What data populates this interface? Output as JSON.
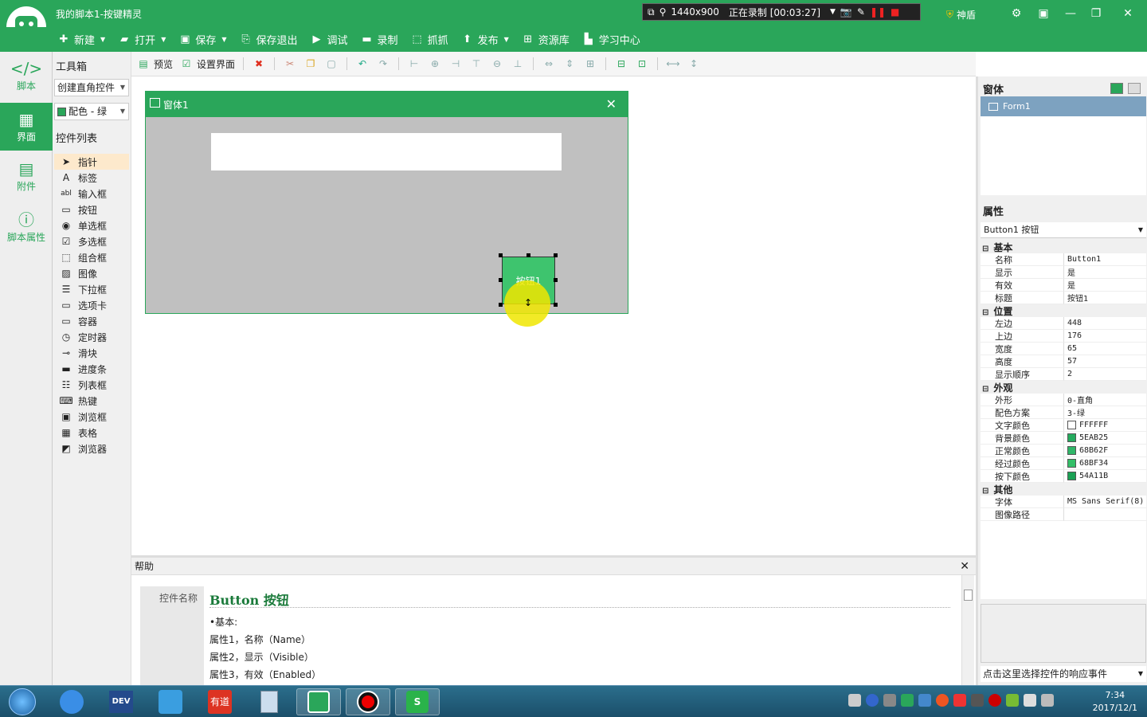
{
  "titlebar": {
    "title": "我的脚本1-按键精灵",
    "resolution": "1440x900",
    "recording": "正在录制 [00:03:27]",
    "shield": "神盾"
  },
  "menu": [
    {
      "label": "新建",
      "icon": "plus-icon",
      "dropdown": true
    },
    {
      "label": "打开",
      "icon": "folder-icon",
      "dropdown": true
    },
    {
      "label": "保存",
      "icon": "save-icon",
      "dropdown": true
    },
    {
      "label": "保存退出",
      "icon": "save-exit-icon",
      "dropdown": false
    },
    {
      "label": "调试",
      "icon": "play-icon",
      "dropdown": false
    },
    {
      "label": "录制",
      "icon": "camera-icon",
      "dropdown": false
    },
    {
      "label": "抓抓",
      "icon": "grab-icon",
      "dropdown": false
    },
    {
      "label": "发布",
      "icon": "publish-icon",
      "dropdown": true
    },
    {
      "label": "资源库",
      "icon": "resource-icon",
      "dropdown": false
    },
    {
      "label": "学习中心",
      "icon": "learn-icon",
      "dropdown": false
    }
  ],
  "leftnav": [
    {
      "label": "脚本",
      "icon": "script-icon"
    },
    {
      "label": "界面",
      "icon": "ui-icon",
      "active": true
    },
    {
      "label": "附件",
      "icon": "attachment-icon"
    },
    {
      "label": "脚本属性",
      "icon": "info-icon"
    }
  ],
  "toolbox": {
    "title": "工具箱",
    "create_mode": "创建直角控件",
    "color_scheme": "配色 - 绿",
    "list_title": "控件列表",
    "controls": [
      {
        "label": "指针",
        "icon": "pointer-icon",
        "active": true
      },
      {
        "label": "标签",
        "icon": "label-icon"
      },
      {
        "label": "输入框",
        "icon": "textbox-icon"
      },
      {
        "label": "按钮",
        "icon": "button-icon"
      },
      {
        "label": "单选框",
        "icon": "radio-icon"
      },
      {
        "label": "多选框",
        "icon": "checkbox-icon"
      },
      {
        "label": "组合框",
        "icon": "combo-icon"
      },
      {
        "label": "图像",
        "icon": "image-icon"
      },
      {
        "label": "下拉框",
        "icon": "dropdown-icon"
      },
      {
        "label": "选项卡",
        "icon": "tab-icon"
      },
      {
        "label": "容器",
        "icon": "container-icon"
      },
      {
        "label": "定时器",
        "icon": "timer-icon"
      },
      {
        "label": "滑块",
        "icon": "slider-icon"
      },
      {
        "label": "进度条",
        "icon": "progress-icon"
      },
      {
        "label": "列表框",
        "icon": "listbox-icon"
      },
      {
        "label": "热键",
        "icon": "hotkey-icon"
      },
      {
        "label": "浏览框",
        "icon": "browse-icon"
      },
      {
        "label": "表格",
        "icon": "grid-icon"
      },
      {
        "label": "浏览器",
        "icon": "browser-icon"
      }
    ]
  },
  "edittoolbar": {
    "preview": "预览",
    "settings": "设置界面"
  },
  "form": {
    "title": "窗体1",
    "button_caption": "按钮1"
  },
  "help": {
    "title": "帮助",
    "label": "控件名称",
    "heading": "Button 按钮",
    "lines": [
      "•基本:",
      "属性1，名称（Name）",
      "属性2，显示（Visible）",
      "属性3，有效（Enabled）"
    ]
  },
  "rightpanel": {
    "forms_title": "窗体",
    "form_item": "Form1",
    "props_title": "属性",
    "selected": "Button1 按钮",
    "event_hint": "点击这里选择控件的响应事件",
    "props": [
      {
        "cat": "基本"
      },
      {
        "k": "名称",
        "v": "Button1"
      },
      {
        "k": "显示",
        "v": "是"
      },
      {
        "k": "有效",
        "v": "是"
      },
      {
        "k": "标题",
        "v": "按钮1"
      },
      {
        "cat": "位置"
      },
      {
        "k": "左边",
        "v": "448"
      },
      {
        "k": "上边",
        "v": "176"
      },
      {
        "k": "宽度",
        "v": "65"
      },
      {
        "k": "高度",
        "v": "57"
      },
      {
        "k": "显示顺序",
        "v": "2"
      },
      {
        "cat": "外观"
      },
      {
        "k": "外形",
        "v": "0-直角"
      },
      {
        "k": "配色方案",
        "v": "3-绿"
      },
      {
        "k": "文字颜色",
        "v": "FFFFFF",
        "color": "#FFFFFF"
      },
      {
        "k": "背景颜色",
        "v": "5EAB25",
        "color": "#25AB5E"
      },
      {
        "k": "正常颜色",
        "v": "68B62F",
        "color": "#2FB668"
      },
      {
        "k": "经过颜色",
        "v": "68BF34",
        "color": "#34BF68"
      },
      {
        "k": "按下颜色",
        "v": "54A11B",
        "color": "#1BA154"
      },
      {
        "cat": "其他"
      },
      {
        "k": "字体",
        "v": "MS Sans Serif(8)"
      },
      {
        "k": "图像路径",
        "v": ""
      }
    ]
  },
  "taskbar": {
    "time": "7:34",
    "date": "2017/12/1",
    "apps": [
      "start-orb",
      "sogou-icon",
      "devex-icon",
      "app-icon",
      "youdao-icon",
      "calculator-icon",
      "anjian-icon",
      "record-icon",
      "wps-icon"
    ]
  },
  "colors": {
    "accent": "#2aa65a",
    "selection": "#7da2c0"
  }
}
